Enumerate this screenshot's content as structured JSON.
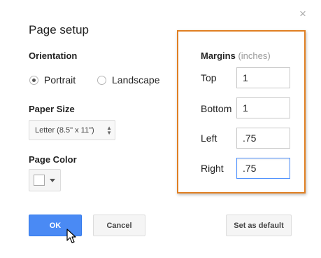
{
  "dialog": {
    "title": "Page setup",
    "close_glyph": "×"
  },
  "orientation": {
    "label": "Orientation",
    "options": [
      {
        "label": "Portrait",
        "selected": true
      },
      {
        "label": "Landscape",
        "selected": false
      }
    ]
  },
  "paper_size": {
    "label": "Paper Size",
    "value": "Letter (8.5\" x 11\")",
    "arrows": "▲▼"
  },
  "page_color": {
    "label": "Page Color",
    "value": "#ffffff"
  },
  "margins": {
    "title": "Margins",
    "unit": "(inches)",
    "fields": [
      {
        "label": "Top",
        "value": "1"
      },
      {
        "label": "Bottom",
        "value": "1"
      },
      {
        "label": "Left",
        "value": ".75"
      },
      {
        "label": "Right",
        "value": ".75"
      }
    ],
    "highlight_color": "#e07f22"
  },
  "buttons": {
    "ok": "OK",
    "cancel": "Cancel",
    "set_default": "Set as default"
  },
  "colors": {
    "accent": "#4a8af4",
    "focus": "#4d90fe"
  }
}
